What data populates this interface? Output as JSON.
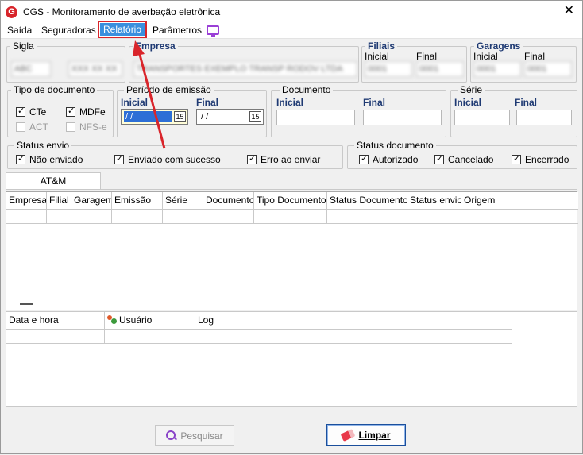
{
  "window": {
    "title": "CGS - Monitoramento de averbação eletrônica",
    "app_icon_letter": "G"
  },
  "menu": {
    "items": [
      "Saída",
      "Seguradoras",
      "Relatório",
      "Parâmetros"
    ],
    "active": "Relatório"
  },
  "sigla": {
    "label": "Sigla",
    "value_blurred": "ABC",
    "value2_blurred": "XXX XX XX"
  },
  "empresa": {
    "label": "Empresa",
    "value_blurred": "TRANSPORTES EXEMPLO TRANSP RODOV LTDA"
  },
  "filiais": {
    "label": "Filiais",
    "inicial_label": "Inicial",
    "final_label": "Final",
    "inicial_value": "0001",
    "final_value": "0001"
  },
  "garagens": {
    "label": "Garagens",
    "inicial_label": "Inicial",
    "final_label": "Final",
    "inicial_value": "0001",
    "final_value": "0001"
  },
  "tipo_documento": {
    "label": "Tipo de documento",
    "cte": "CTe",
    "mdfe": "MDFe",
    "act": "ACT",
    "nfse": "NFS-e"
  },
  "periodo_emissao": {
    "label": "Período de emissão",
    "inicial_label": "Inicial",
    "final_label": "Final",
    "inicial_value": "/ /",
    "final_value": "/ /",
    "calendar_glyph": "15"
  },
  "documento": {
    "label": "Documento",
    "inicial_label": "Inicial",
    "final_label": "Final"
  },
  "serie": {
    "label": "Série",
    "inicial_label": "Inicial",
    "final_label": "Final"
  },
  "status_envio": {
    "label": "Status envio",
    "nao_enviado": "Não enviado",
    "enviado_sucesso": "Enviado com sucesso",
    "erro_enviar": "Erro ao enviar"
  },
  "status_documento": {
    "label": "Status documento",
    "autorizado": "Autorizado",
    "cancelado": "Cancelado",
    "encerrado": "Encerrado"
  },
  "tab": {
    "label": "AT&M"
  },
  "main_grid": {
    "columns": [
      "Empresa",
      "Filial",
      "Garagem",
      "Emissão",
      "Série",
      "Documento",
      "Tipo Documento",
      "Status Documento",
      "Status envio",
      "Origem"
    ]
  },
  "log_grid": {
    "columns": [
      "Data e hora",
      "Usuário",
      "Log"
    ]
  },
  "buttons": {
    "pesquisar": "Pesquisar",
    "limpar": "Limpar"
  },
  "annotation": {
    "arrow_color": "#d9252b"
  }
}
